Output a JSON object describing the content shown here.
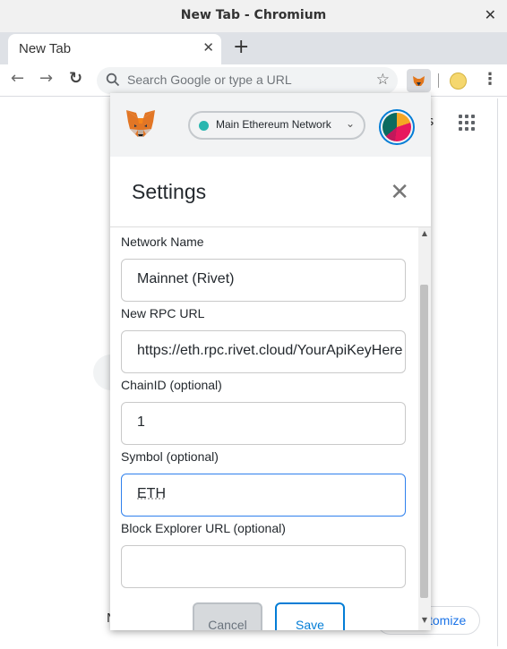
{
  "window": {
    "title": "New Tab - Chromium",
    "close_glyph": "✕"
  },
  "tabs": [
    {
      "label": "New Tab",
      "close_glyph": "✕"
    }
  ],
  "new_tab_glyph": "+",
  "toolbar": {
    "back_glyph": "←",
    "forward_glyph": "→",
    "reload_glyph": "↻",
    "omnibox_placeholder": "Search Google or type a URL",
    "star_glyph": "☆",
    "menu_glyph": "⋮"
  },
  "background_page": {
    "apps_text": "s",
    "customize_label": "tomize",
    "partial_left_text": "N"
  },
  "metamask": {
    "network": {
      "label": "Main Ethereum Network",
      "dot_color": "#29b6af",
      "chevron_glyph": "⌄"
    },
    "settings": {
      "title": "Settings",
      "close_glyph": "✕",
      "fields": [
        {
          "label": "Network Name",
          "value": "Mainnet (Rivet)"
        },
        {
          "label": "New RPC URL",
          "value": "https://eth.rpc.rivet.cloud/YourApiKeyHere"
        },
        {
          "label": "ChainID (optional)",
          "value": "1"
        },
        {
          "label": "Symbol (optional)",
          "value": "ETH"
        },
        {
          "label": "Block Explorer URL (optional)",
          "value": ""
        }
      ],
      "cancel_label": "Cancel",
      "save_label": "Save",
      "accent_color": "#037dd6"
    }
  }
}
